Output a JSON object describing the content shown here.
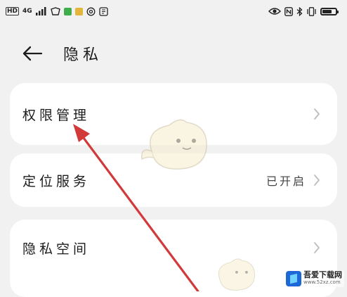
{
  "status_bar": {
    "network_chip": "HD",
    "signal_label": "4G",
    "right_icons": [
      "eye-icon",
      "nfc-icon",
      "bluetooth-icon",
      "vibrate-icon",
      "battery-icon"
    ]
  },
  "header": {
    "back_icon": "back-arrow-icon",
    "title": "隐私"
  },
  "items": [
    {
      "label": "权限管理",
      "value": ""
    },
    {
      "label": "定位服务",
      "value": "已开启"
    },
    {
      "label": "隐私空间",
      "value": ""
    }
  ],
  "watermark": {
    "logo_icon": "site-logo-icon",
    "text": "吾爱下载网",
    "sub": "www.52xz.com"
  },
  "colors": {
    "background": "#f1f1f1",
    "card": "#ffffff",
    "annotation_arrow": "#d23a3a"
  }
}
